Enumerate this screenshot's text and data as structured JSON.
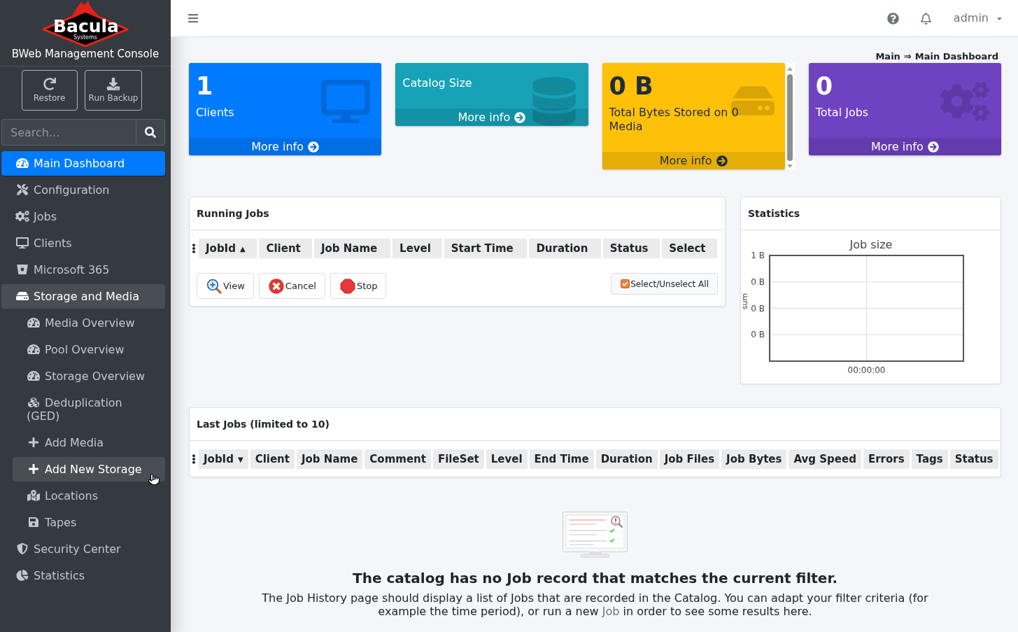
{
  "sidebar": {
    "logo": {
      "wordmark": "Bacula",
      "tagline": "Systems"
    },
    "title": "BWeb Management Console",
    "actions": [
      "Restore",
      "Run Backup"
    ],
    "search": {
      "placeholder": "Search..."
    },
    "menu": [
      {
        "label": "Main Dashboard",
        "selected": true,
        "expanded": false
      },
      {
        "label": "Configuration",
        "selected": false,
        "expanded": false
      },
      {
        "label": "Jobs",
        "selected": false,
        "expanded": false
      },
      {
        "label": "Clients",
        "selected": false,
        "expanded": false
      },
      {
        "label": "Microsoft 365",
        "selected": false,
        "expanded": false
      },
      {
        "label": "Storage and Media",
        "selected": false,
        "expanded": true,
        "children": [
          {
            "label": "Media Overview",
            "selected": false,
            "hovered": false
          },
          {
            "label": "Pool Overview",
            "selected": false,
            "hovered": false
          },
          {
            "label": "Storage Overview",
            "selected": false,
            "hovered": false
          },
          {
            "label": "Deduplication (GED)",
            "selected": false,
            "hovered": false
          },
          {
            "label": "Add Media",
            "selected": false,
            "hovered": false
          },
          {
            "label": "Add New Storage",
            "selected": false,
            "hovered": true
          },
          {
            "label": "Locations",
            "selected": false,
            "hovered": false
          },
          {
            "label": "Tapes",
            "selected": false,
            "hovered": false
          }
        ]
      },
      {
        "label": "Security Center",
        "selected": false,
        "expanded": false
      },
      {
        "label": "Statistics",
        "selected": false,
        "expanded": false
      }
    ]
  },
  "topbar": {
    "user": "admin"
  },
  "breadcrumb": {
    "items": [
      "Main",
      "Main Dashboard"
    ],
    "separator": "⇒"
  },
  "stat_cards": [
    {
      "value": "1",
      "label": "Clients",
      "link": "More info",
      "color": "#007bff",
      "scrollbar": false
    },
    {
      "label": "Catalog Size",
      "link": "More info",
      "color": "#17a2b8",
      "scrollbar": false
    },
    {
      "value": "0 B",
      "label": "Total Bytes Stored on 0 Media",
      "link": "More info",
      "color": "#ffc107",
      "scrollbar": true
    },
    {
      "value": "0",
      "label": "Total Jobs",
      "link": "More info",
      "color": "#6f42c1",
      "scrollbar": false
    }
  ],
  "running_jobs": {
    "title": "Running Jobs",
    "columns": [
      {
        "label": "JobId",
        "sort_mark": "▲"
      },
      {
        "label": "Client"
      },
      {
        "label": "Job Name"
      },
      {
        "label": "Level"
      },
      {
        "label": "Start Time"
      },
      {
        "label": "Duration"
      },
      {
        "label": "Status"
      },
      {
        "label": "Select"
      }
    ],
    "actions": [
      "View",
      "Cancel",
      "Stop"
    ],
    "select_all": "Select/Unselect All"
  },
  "statistics": {
    "title": "Statistics",
    "chart_data": {
      "type": "line",
      "title": "Job size",
      "ylabel": "sum",
      "categories": [
        "00:00:00"
      ],
      "values": [
        null
      ],
      "ylim": [
        0,
        1
      ],
      "yticks": [
        {
          "value": 1,
          "label": "1 B"
        },
        {
          "value": 0.75,
          "label": "0 B"
        },
        {
          "value": 0.5,
          "label": "0 B"
        },
        {
          "value": 0.25,
          "label": "0 B"
        }
      ],
      "grid": true
    }
  },
  "last_jobs": {
    "title": "Last Jobs (limited to 10)",
    "columns": [
      {
        "label": "JobId",
        "sort_mark": "▼"
      },
      {
        "label": "Client"
      },
      {
        "label": "Job Name"
      },
      {
        "label": "Comment"
      },
      {
        "label": "FileSet"
      },
      {
        "label": "Level"
      },
      {
        "label": "End Time"
      },
      {
        "label": "Duration"
      },
      {
        "label": "Job Files"
      },
      {
        "label": "Job Bytes"
      },
      {
        "label": "Avg Speed"
      },
      {
        "label": "Errors"
      },
      {
        "label": "Tags"
      },
      {
        "label": "Status"
      }
    ]
  },
  "empty_state": {
    "title": "The catalog has no Job record that matches the current filter.",
    "text": "The Job History page should display a list of Jobs that are recorded in the Catalog. You can adapt your filter criteria (for example the time period), or run a new",
    "link": "Job",
    "text_end": "in order to see some results here."
  }
}
